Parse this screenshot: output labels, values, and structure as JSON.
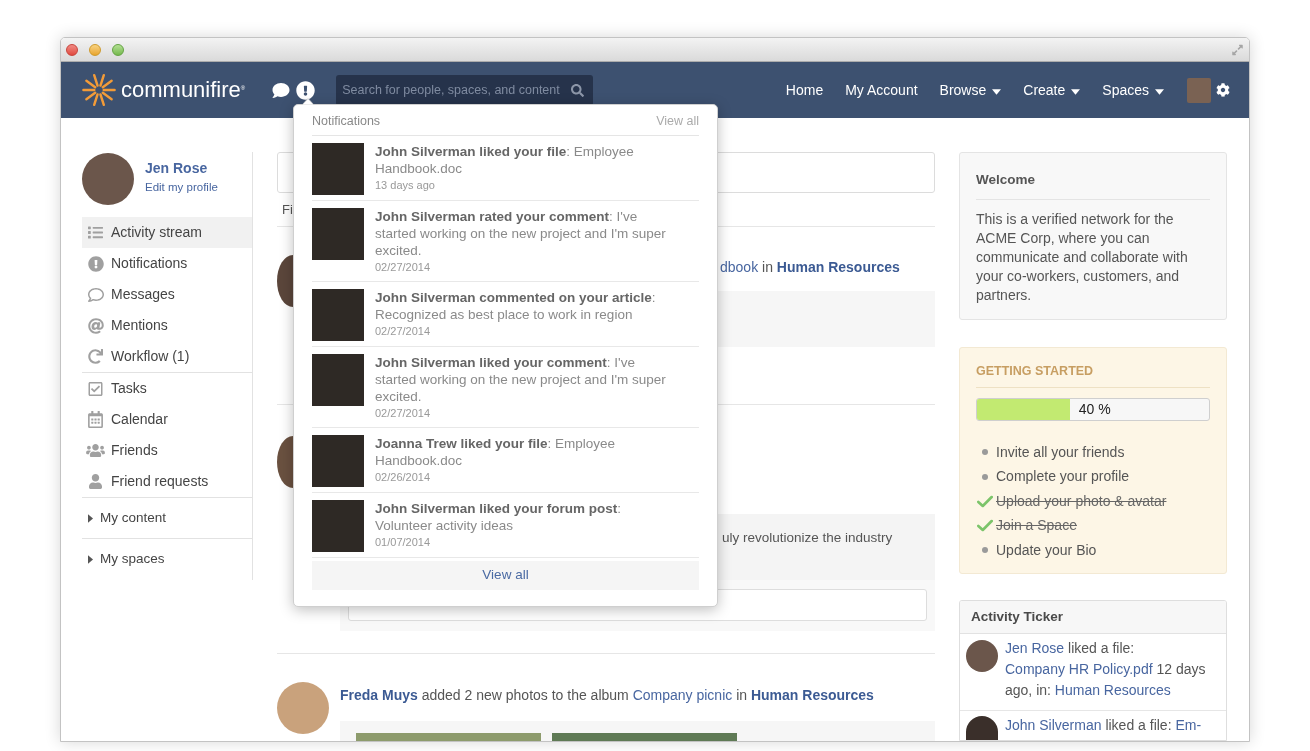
{
  "navbar": {
    "logo": "communifire$^{®}$",
    "search": {
      "placeholder": "Search for people, spaces, and content"
    },
    "links": [
      {
        "label": "Home",
        "dropdown": false
      },
      {
        "label": "My Account",
        "dropdown": false
      },
      {
        "label": "Browse",
        "dropdown": true
      },
      {
        "label": "Create",
        "dropdown": true
      },
      {
        "label": "Spaces",
        "dropdown": true
      }
    ]
  },
  "sidebar": {
    "profile": {
      "name": "Jen Rose",
      "edit_link": "Edit my profile"
    },
    "groups": [
      {
        "items": [
          {
            "label": "Activity stream",
            "selected": true
          },
          {
            "label": "Notifications",
            "selected": false
          },
          {
            "label": "Messages",
            "selected": false
          },
          {
            "label": "Mentions",
            "selected": false
          },
          {
            "label": "Workflow (1)",
            "selected": false
          }
        ]
      },
      {
        "items": [
          {
            "label": "Tasks",
            "selected": false
          },
          {
            "label": "Calendar",
            "selected": false
          },
          {
            "label": "Friends",
            "selected": false
          },
          {
            "label": "Friend requests",
            "selected": false
          }
        ]
      }
    ],
    "sections": [
      {
        "label": "My content",
        "expanded": false
      },
      {
        "label": "My spaces",
        "expanded": false
      }
    ]
  },
  "feed": {
    "label_fragment": "Fi",
    "posts": [
      {
        "kind": "file",
        "headline": [
          {
            "kind": "link",
            "text": "dbook"
          },
          {
            "kind": "text",
            "text": "in"
          },
          {
            "kind": "strong_link",
            "text": "Human Resources"
          }
        ]
      },
      {
        "kind": "status",
        "excerpt": "uly revolutionize the industry"
      },
      {
        "kind": "album",
        "headline": [
          {
            "kind": "strong_link",
            "text": "Freda Muys"
          },
          {
            "kind": "text",
            "text": "added 2 new photos to the album"
          },
          {
            "kind": "link",
            "text": "Company picnic"
          },
          {
            "kind": "text",
            "text": "in"
          },
          {
            "kind": "strong_link",
            "text": "Human Resources"
          }
        ]
      }
    ]
  },
  "notifications": {
    "title": "Notifications",
    "header_link": "View all",
    "items": [
      {
        "text": "**John Silverman liked your file**: Employee Handbook.doc",
        "time": "13 days ago"
      },
      {
        "text": "**John Silverman rated your comment**: I've started working on the new project and I'm super excited.",
        "time": "02/27/2014"
      },
      {
        "text": "**John Silverman commented on your article**: Recognized as best place to work in region",
        "time": "02/27/2014"
      },
      {
        "text": "**John Silverman liked your comment**: I've started working on the new project and I'm super excited.",
        "time": "02/27/2014"
      },
      {
        "text": "**Joanna Trew liked your file**: Employee Handbook.doc",
        "time": "02/26/2014"
      },
      {
        "text": "**John Silverman liked your forum post**: Volunteer activity ideas",
        "time": "01/07/2014"
      }
    ],
    "footer_link": "View all"
  },
  "welcome": {
    "title": "Welcome",
    "body": "This is a verified network for the ACME Corp, where you can communicate and collaborate with your co-workers, customers, and partners."
  },
  "getting_started": {
    "title": "GETTING STARTED",
    "progress": {
      "level": 0.4,
      "reading": "40 %"
    },
    "tasks": [
      {
        "label": "Invite all your friends",
        "checked": false
      },
      {
        "label": "Complete your profile",
        "checked": false
      },
      {
        "label": "Upload your photo & avatar",
        "checked": true
      },
      {
        "label": "Join a Space",
        "checked": true
      },
      {
        "label": "Update your Bio",
        "checked": false
      }
    ]
  },
  "activity_ticker": {
    "title": "Activity Ticker",
    "entries": [
      {
        "segments": [
          {
            "kind": "link",
            "text": "Jen Rose"
          },
          {
            "kind": "text",
            "text": "liked a file:"
          },
          {
            "kind": "link",
            "text": "Company HR Policy.pdf"
          },
          {
            "kind": "text",
            "text": "12 days ago, in:"
          },
          {
            "kind": "link",
            "text": "Human Resources"
          }
        ]
      },
      {
        "segments": [
          {
            "kind": "link",
            "text": "John Silverman"
          },
          {
            "kind": "text",
            "text": "liked a file:"
          },
          {
            "kind": "link",
            "text": "Em-"
          }
        ]
      }
    ]
  }
}
